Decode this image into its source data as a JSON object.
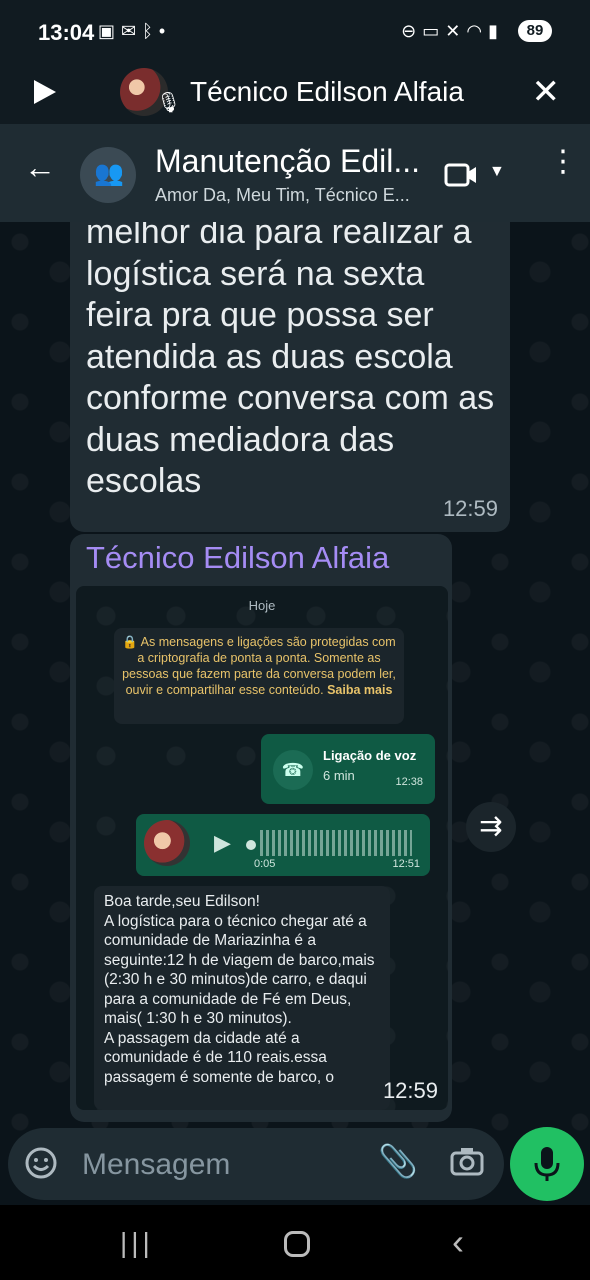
{
  "status_bar": {
    "time": "13:04",
    "battery": "89",
    "left_icons": [
      "screenshot-icon",
      "mail-icon",
      "bluetooth-icon",
      "dot-icon"
    ],
    "right_icons": [
      "dnd-icon",
      "sleep-icon",
      "mute-icon",
      "wifi-icon",
      "signal-icon"
    ]
  },
  "call_bar": {
    "contact_name": "Técnico Edilson Alfaia"
  },
  "header": {
    "title": "Manutenção Edil...",
    "subtitle": "Amor Da, Meu Tim, Técnico E..."
  },
  "messages": {
    "msg1_text": "melhor dia para realizar a logística será na sexta feira pra que possa ser atendida as duas escola conforme conversa com as duas mediadora das escolas",
    "msg1_time": "12:59",
    "msg2_sender": "Técnico Edilson Alfaia",
    "msg2_time": "12:59",
    "screenshot": {
      "date_label": "Hoje",
      "encryption_notice": "🔒 As mensagens e ligações são protegidas com a criptografia de ponta a ponta. Somente as pessoas que fazem parte da conversa podem ler, ouvir e compartilhar esse conteúdo.",
      "learn_more": "Saiba mais",
      "voice_call_label": "Ligação de voz",
      "voice_call_duration": "6 min",
      "voice_call_time": "12:38",
      "audio_duration": "0:05",
      "audio_time": "12:51",
      "incoming_text": "Boa tarde,seu Edilson!\nA logística para o técnico chegar até a comunidade de Mariazinha é a seguinte:12 h de viagem de barco,mais (2:30 h e 30 minutos)de carro, e daqui para a comunidade de Fé em Deus, mais( 1:30 h e 30 minutos).\nA passagem da cidade até a comunidade é de 110 reais.essa passagem é somente de barco, o"
    }
  },
  "composer": {
    "placeholder": "Mensagem"
  },
  "colors": {
    "accent_green": "#21c063",
    "sender_purple": "#a58cf4",
    "bubble_dark": "#202c33"
  }
}
